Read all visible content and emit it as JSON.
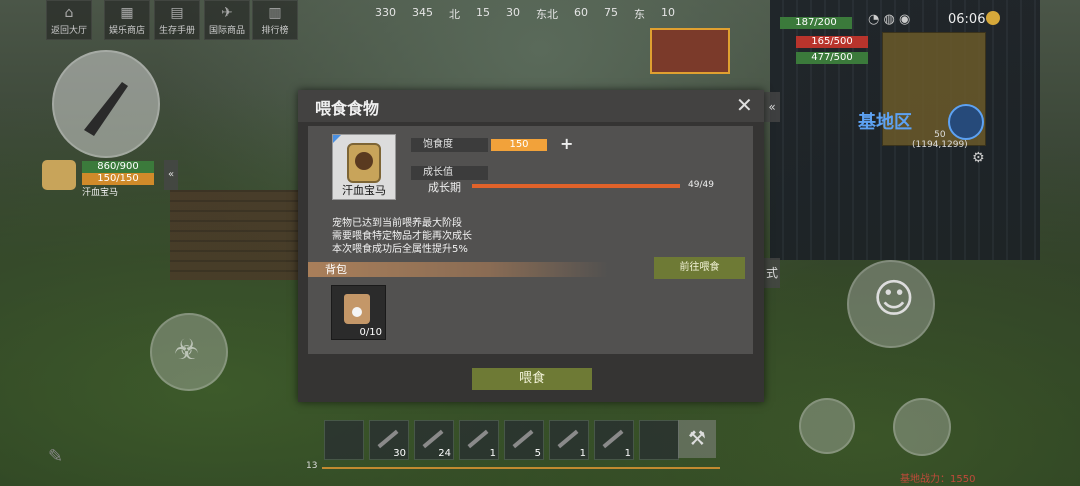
{
  "hud": {
    "top_buttons": [
      {
        "label": "返回大厅",
        "icon": "home-icon"
      },
      {
        "label": "娱乐商店",
        "icon": "shop-icon"
      },
      {
        "label": "生存手册",
        "icon": "book-icon"
      },
      {
        "label": "国际商品",
        "icon": "plane-icon"
      },
      {
        "label": "排行榜",
        "icon": "ranking-icon"
      }
    ],
    "compass": [
      "330",
      "345",
      "北",
      "15",
      "30",
      "东北",
      "60",
      "75",
      "东",
      "10"
    ],
    "time": "06:06",
    "player_hp": "187/200",
    "stat2": "165/500",
    "stat3": "477/500",
    "pet_hp": "860/900",
    "pet_stat": "150/150",
    "pet_label": "汗血宝马",
    "zone": "基地区",
    "zone_level": "50",
    "coords": "(1194,1299)",
    "side_tab_arrow": "«",
    "side_tab_text": "式",
    "level_num": "13",
    "power_text": "基地战力：1550"
  },
  "dialog": {
    "title": "喂食食物",
    "close_icon": "close-icon",
    "pet_name": "汗血宝马",
    "satiety_label": "饱食度",
    "satiety_value": "150",
    "growth_section_label": "成长值",
    "growth_stage_label": "成长期",
    "growth_value": "49/49",
    "growth_current": 49,
    "growth_max": 49,
    "desc_lines": [
      "宠物已达到当前喂养最大阶段",
      "需要喂食特定物品才能再次成长",
      "本次喂食成功后全属性提升5%"
    ],
    "bag_label": "背包",
    "goto_button": "前往喂食",
    "item_count": "0/10",
    "feed_button": "喂食"
  },
  "hotbar": {
    "slots": [
      {
        "count": ""
      },
      {
        "count": "30"
      },
      {
        "count": "24"
      },
      {
        "count": "1"
      },
      {
        "count": "5"
      },
      {
        "count": "1"
      },
      {
        "count": "1"
      },
      {
        "count": ""
      }
    ]
  },
  "colors": {
    "accent_green": "#6e7a35",
    "satiety": "#f2a23a",
    "growth": "#e0622a",
    "zone_blue": "#5da2f3"
  }
}
